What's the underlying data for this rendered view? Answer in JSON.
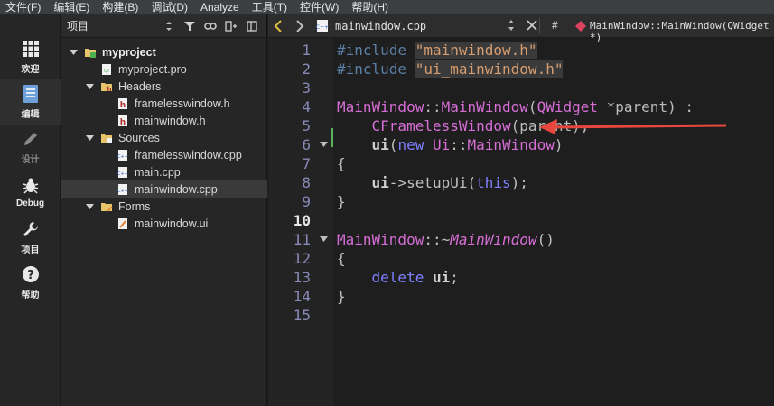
{
  "menubar": {
    "items": [
      "文件(F)",
      "编辑(E)",
      "构建(B)",
      "调试(D)",
      "Analyze",
      "工具(T)",
      "控件(W)",
      "帮助(H)"
    ]
  },
  "modebar": {
    "items": [
      {
        "label": "欢迎",
        "icon": "grid-icon"
      },
      {
        "label": "编辑",
        "icon": "document-icon"
      },
      {
        "label": "设计",
        "icon": "pencil-icon"
      },
      {
        "label": "Debug",
        "icon": "bug-icon"
      },
      {
        "label": "项目",
        "icon": "wrench-icon"
      },
      {
        "label": "帮助",
        "icon": "help-icon"
      }
    ]
  },
  "project_panel": {
    "title": "项目",
    "tree": [
      {
        "label": "myproject",
        "level": 0,
        "expanded": true,
        "icon": "project-folder-icon"
      },
      {
        "label": "myproject.pro",
        "level": 1,
        "icon": "pro-file-icon"
      },
      {
        "label": "Headers",
        "level": 1,
        "expanded": true,
        "icon": "headers-folder-icon"
      },
      {
        "label": "framelesswindow.h",
        "level": 2,
        "icon": "header-file-icon"
      },
      {
        "label": "mainwindow.h",
        "level": 2,
        "icon": "header-file-icon"
      },
      {
        "label": "Sources",
        "level": 1,
        "expanded": true,
        "icon": "sources-folder-icon"
      },
      {
        "label": "framelesswindow.cpp",
        "level": 2,
        "icon": "cpp-file-icon"
      },
      {
        "label": "main.cpp",
        "level": 2,
        "icon": "cpp-file-icon"
      },
      {
        "label": "mainwindow.cpp",
        "level": 2,
        "icon": "cpp-file-icon",
        "selected": true
      },
      {
        "label": "Forms",
        "level": 1,
        "expanded": true,
        "icon": "forms-folder-icon"
      },
      {
        "label": "mainwindow.ui",
        "level": 2,
        "icon": "ui-file-icon"
      }
    ]
  },
  "editor": {
    "file_name": "mainwindow.cpp",
    "hash_symbol": "#",
    "symbol": "MainWindow::MainWindow(QWidget *)",
    "current_line": 10,
    "line_numbers": [
      "1",
      "2",
      "3",
      "4",
      "5",
      "6",
      "7",
      "8",
      "9",
      "10",
      "11",
      "12",
      "13",
      "14",
      "15"
    ],
    "lines": [
      [
        {
          "t": "#include ",
          "c": "pp"
        },
        {
          "t": "\"mainwindow.h\"",
          "c": "str"
        }
      ],
      [
        {
          "t": "#include ",
          "c": "pp"
        },
        {
          "t": "\"ui_mainwindow.h\"",
          "c": "str"
        }
      ],
      [],
      [
        {
          "t": "MainWindow",
          "c": "cls"
        },
        {
          "t": "::",
          "c": "punct"
        },
        {
          "t": "MainWindow",
          "c": "cls"
        },
        {
          "t": "(",
          "c": "punct"
        },
        {
          "t": "QWidget",
          "c": "cls"
        },
        {
          "t": " *parent) ",
          "c": "param"
        },
        {
          "t": ":",
          "c": "punct"
        }
      ],
      [
        {
          "t": "    CFramelessWindow",
          "c": "cls"
        },
        {
          "t": "(parent),",
          "c": "param"
        }
      ],
      [
        {
          "t": "    ",
          "c": "punct"
        },
        {
          "t": "ui",
          "c": "memb"
        },
        {
          "t": "(",
          "c": "punct"
        },
        {
          "t": "new ",
          "c": "kw"
        },
        {
          "t": "Ui",
          "c": "cls"
        },
        {
          "t": "::",
          "c": "punct"
        },
        {
          "t": "MainWindow",
          "c": "cls"
        },
        {
          "t": ")",
          "c": "punct"
        }
      ],
      [
        {
          "t": "{",
          "c": "punct"
        }
      ],
      [
        {
          "t": "    ",
          "c": "punct"
        },
        {
          "t": "ui",
          "c": "memb"
        },
        {
          "t": "->setupUi(",
          "c": "punct"
        },
        {
          "t": "this",
          "c": "kw"
        },
        {
          "t": ");",
          "c": "punct"
        }
      ],
      [
        {
          "t": "}",
          "c": "punct"
        }
      ],
      [],
      [
        {
          "t": "MainWindow",
          "c": "cls"
        },
        {
          "t": "::~",
          "c": "punct"
        },
        {
          "t": "MainWindow",
          "c": "ital"
        },
        {
          "t": "()",
          "c": "punct"
        }
      ],
      [
        {
          "t": "{",
          "c": "punct"
        }
      ],
      [
        {
          "t": "    ",
          "c": "punct"
        },
        {
          "t": "delete ",
          "c": "kw"
        },
        {
          "t": "ui",
          "c": "memb"
        },
        {
          "t": ";",
          "c": "punct"
        }
      ],
      [
        {
          "t": "}",
          "c": "punct"
        }
      ],
      []
    ],
    "fold_lines": [
      6,
      11
    ],
    "annotation_color": "#e8473f"
  }
}
